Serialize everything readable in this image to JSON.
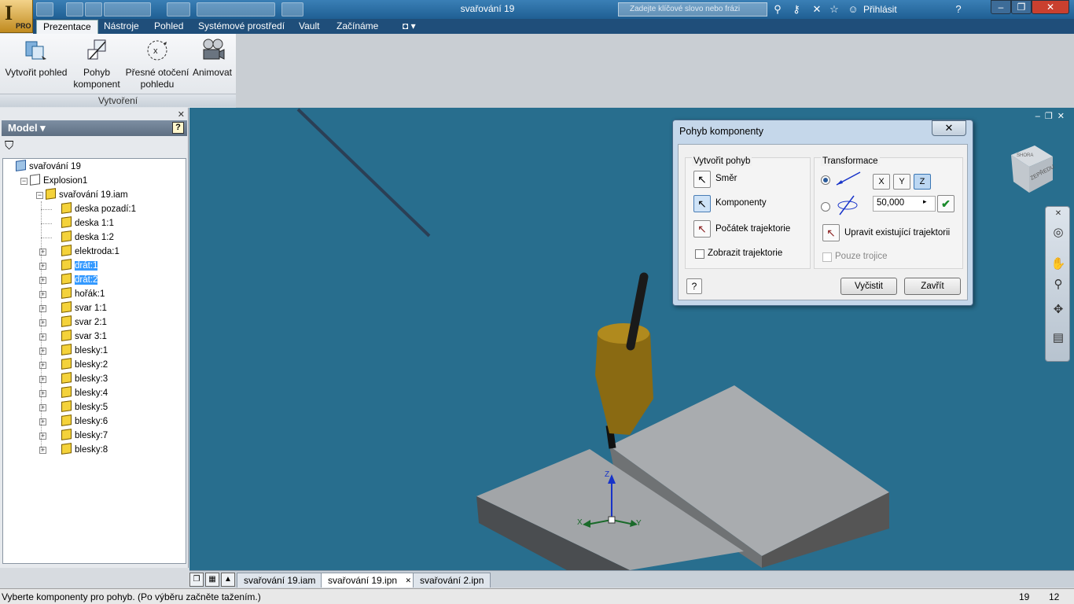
{
  "window": {
    "document_title": "svařování 19",
    "search_placeholder": "Zadejte klíčové slovo nebo frázi",
    "login_label": "Přihlásit",
    "app_badge": "PRO"
  },
  "ribbon": {
    "tabs": [
      "Prezentace",
      "Nástroje",
      "Pohled",
      "Systémové prostředí",
      "Vault",
      "Začínáme"
    ],
    "active_tab": "Prezentace",
    "buttons": [
      {
        "line1": "Vytvořit pohled",
        "line2": ""
      },
      {
        "line1": "Pohyb",
        "line2": "komponent"
      },
      {
        "line1": "Přesné otočení",
        "line2": "pohledu"
      },
      {
        "line1": "Animovat",
        "line2": ""
      }
    ],
    "panel_label": "Vytvoření"
  },
  "browser": {
    "header": "Model ▾",
    "help": "?",
    "tree": [
      {
        "label": "svařování 19",
        "level": 0,
        "selected": false
      },
      {
        "label": "Explosion1",
        "level": 1,
        "selected": false
      },
      {
        "label": "svařování 19.iam",
        "level": 2,
        "selected": false
      },
      {
        "label": "deska pozadí:1",
        "level": 3,
        "selected": false
      },
      {
        "label": "deska 1:1",
        "level": 3,
        "selected": false
      },
      {
        "label": "deska 1:2",
        "level": 3,
        "selected": false
      },
      {
        "label": "elektroda:1",
        "level": 3,
        "selected": false
      },
      {
        "label": "drát:1",
        "level": 3,
        "selected": true
      },
      {
        "label": "drát:2",
        "level": 3,
        "selected": true
      },
      {
        "label": "hořák:1",
        "level": 3,
        "selected": false
      },
      {
        "label": "svar 1:1",
        "level": 3,
        "selected": false
      },
      {
        "label": "svar 2:1",
        "level": 3,
        "selected": false
      },
      {
        "label": "svar 3:1",
        "level": 3,
        "selected": false
      },
      {
        "label": "blesky:1",
        "level": 3,
        "selected": false
      },
      {
        "label": "blesky:2",
        "level": 3,
        "selected": false
      },
      {
        "label": "blesky:3",
        "level": 3,
        "selected": false
      },
      {
        "label": "blesky:4",
        "level": 3,
        "selected": false
      },
      {
        "label": "blesky:5",
        "level": 3,
        "selected": false
      },
      {
        "label": "blesky:6",
        "level": 3,
        "selected": false
      },
      {
        "label": "blesky:7",
        "level": 3,
        "selected": false
      },
      {
        "label": "blesky:8",
        "level": 3,
        "selected": false
      }
    ]
  },
  "dialog": {
    "title": "Pohyb komponenty",
    "close": "✕",
    "create_group": "Vytvořit pohyb",
    "direction": "Směr",
    "components": "Komponenty",
    "trajectory_origin": "Počátek trajektorie",
    "show_trajectories": "Zobrazit trajektorie",
    "transform_group": "Transformace",
    "axes": [
      "X",
      "Y",
      "Z"
    ],
    "active_axis": "Z",
    "value": "50,000",
    "edit_trajectory": "Upravit existující trajektorii",
    "triad_only": "Pouze trojice",
    "help": "?",
    "clear": "Vyčistit",
    "close_button": "Zavřít"
  },
  "viewcube": {
    "front_label": "ZEPŘEDU",
    "top_label": "SHORA"
  },
  "doc_tabs": [
    {
      "label": "svařování 19.iam",
      "active": false
    },
    {
      "label": "svařování 19.ipn",
      "active": true
    },
    {
      "label": "svařování 2.ipn",
      "active": false
    }
  ],
  "triad": {
    "x": "X",
    "y": "Y",
    "z": "Z"
  },
  "status": {
    "text": "Vyberte komponenty pro pohyb. (Po výběru začněte tažením.)",
    "n1": "19",
    "n2": "12"
  }
}
